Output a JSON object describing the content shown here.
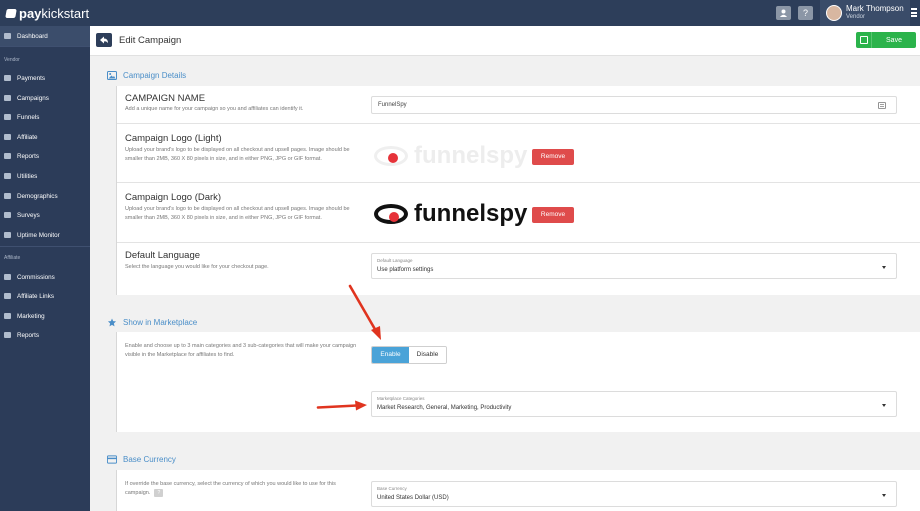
{
  "topbar": {
    "logo_pay": "pay",
    "logo_rest": "kickstart",
    "user_name": "Mark Thompson",
    "user_role": "Vendor",
    "help_label": "?"
  },
  "sidebar": {
    "top_items": [
      {
        "label": "Dashboard",
        "icon": "grid-icon"
      }
    ],
    "vendor_heading": "Vendor",
    "vendor_items": [
      {
        "label": "Payments",
        "icon": "cart-icon"
      },
      {
        "label": "Campaigns",
        "icon": "list-icon"
      },
      {
        "label": "Funnels",
        "icon": "funnel-icon"
      },
      {
        "label": "Affiliate",
        "icon": "user-icon"
      },
      {
        "label": "Reports",
        "icon": "bar-chart-icon"
      },
      {
        "label": "Utilities",
        "icon": "wrench-icon"
      },
      {
        "label": "Demographics",
        "icon": "globe-icon"
      },
      {
        "label": "Surveys",
        "icon": "doc-icon"
      },
      {
        "label": "Uptime Monitor",
        "icon": "monitor-icon"
      }
    ],
    "affiliate_heading": "Affiliate",
    "affiliate_items": [
      {
        "label": "Commissions",
        "icon": "list-icon"
      },
      {
        "label": "Affiliate Links",
        "icon": "link-icon"
      },
      {
        "label": "Marketing",
        "icon": "megaphone-icon"
      },
      {
        "label": "Reports",
        "icon": "bar-chart-icon"
      }
    ]
  },
  "header": {
    "title": "Edit Campaign",
    "save_label": "Save"
  },
  "campaign_details": {
    "heading": "Campaign Details",
    "name": {
      "title": "CAMPAIGN NAME",
      "desc": "Add a unique name for your campaign so you and affiliates can identify it.",
      "value": "FunnelSpy"
    },
    "logo_light": {
      "title": "Campaign Logo (Light)",
      "desc": "Upload your brand's logo to be displayed on all checkout and upsell pages. Image should be smaller than 2MB, 360 X 80 pixels in size, and in either PNG, JPG or GIF format.",
      "logo_text": "funnelspy",
      "remove_label": "Remove"
    },
    "logo_dark": {
      "title": "Campaign Logo (Dark)",
      "desc": "Upload your brand's logo to be displayed on all checkout and upsell pages. Image should be smaller than 2MB, 360 X 80 pixels in size, and in either PNG, JPG or GIF format.",
      "logo_text": "funnelspy",
      "remove_label": "Remove"
    },
    "language": {
      "title": "Default Language",
      "desc": "Select the language you would like for your checkout page.",
      "select_label": "Default Language",
      "select_value": "Use platform settings"
    }
  },
  "marketplace": {
    "heading": "Show in Marketplace",
    "desc": "Enable and choose up to 3 main categories and 3 sub-categories that will make your campaign visible in the Marketplace for affiliates to find.",
    "enable_label": "Enable",
    "disable_label": "Disable",
    "categories_label": "Marketplace Categories",
    "categories_value": "Market Research, General, Marketing, Productivity"
  },
  "currency": {
    "heading": "Base Currency",
    "desc": "If override the base currency, select the currency of which you would like to use for this campaign.",
    "help": "?",
    "select_label": "Base Currency",
    "select_value": "United States Dollar (USD)"
  },
  "colors": {
    "accent": "#4a8ec8",
    "sidebar": "#2c3c59",
    "save": "#2bb34b",
    "remove": "#df4b4b",
    "enable": "#4aa3d8",
    "arrow": "#e0341f"
  }
}
